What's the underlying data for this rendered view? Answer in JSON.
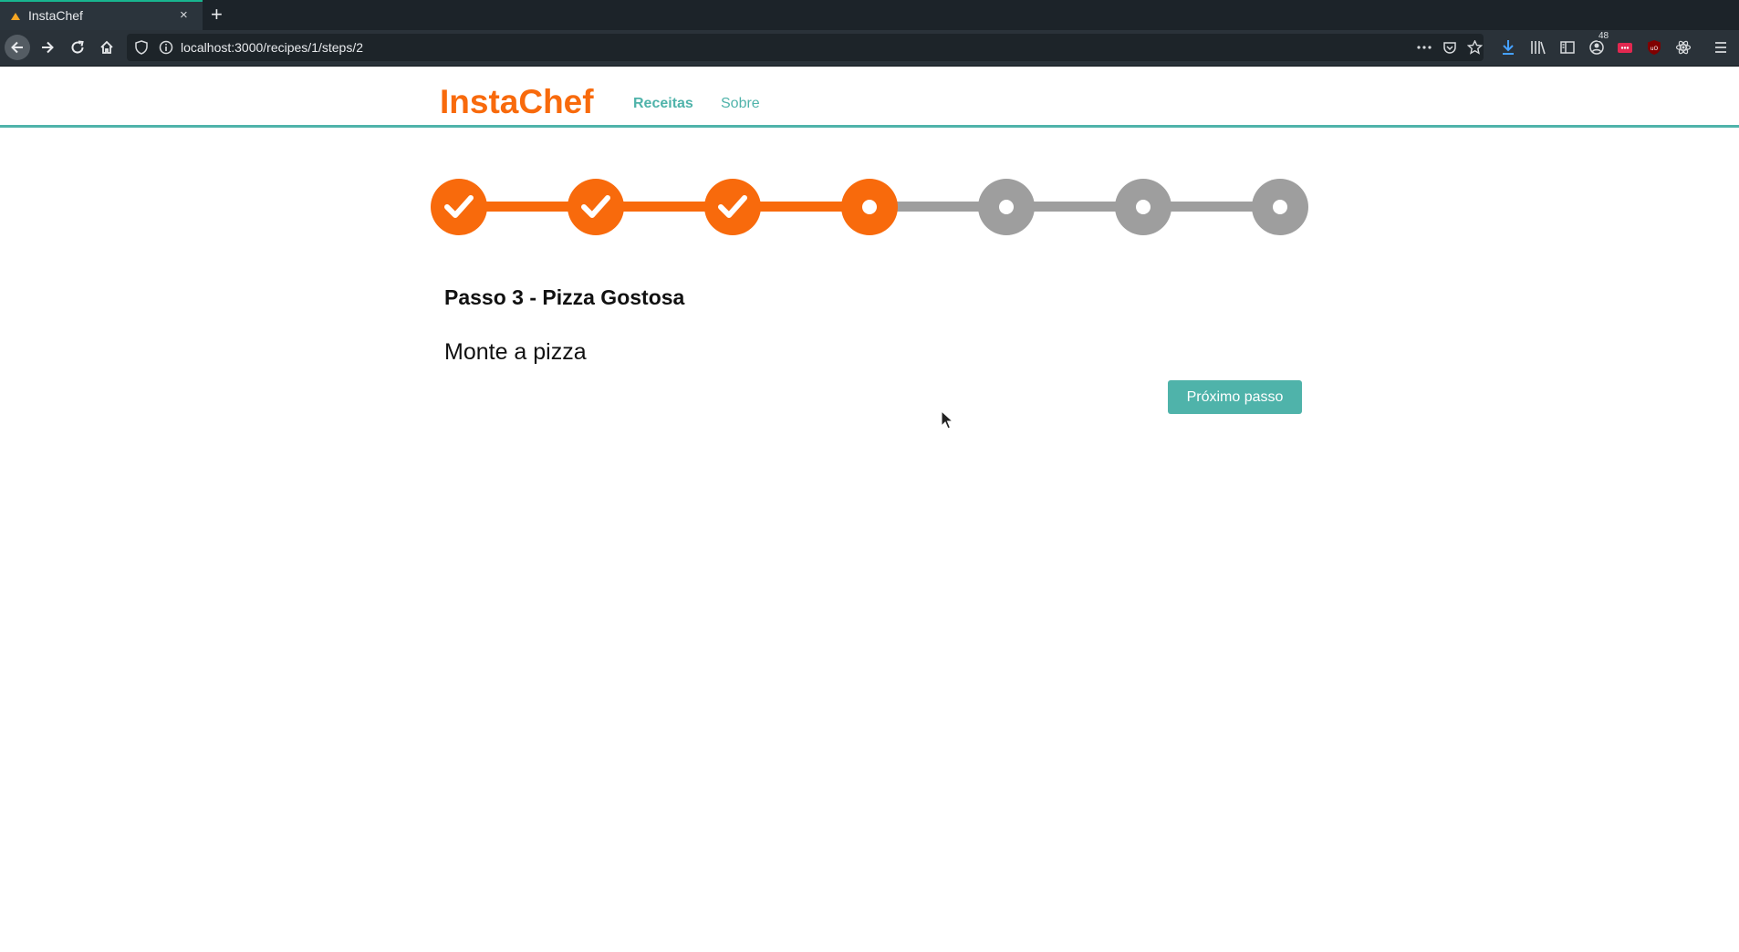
{
  "browser": {
    "tab_title": "InstaChef",
    "new_tab_label": "+",
    "close_label": "×",
    "url": "localhost:3000/recipes/1/steps/2",
    "badge_count": "48"
  },
  "header": {
    "brand": "InstaChef",
    "nav": [
      {
        "label": "Receitas",
        "active": true
      },
      {
        "label": "Sobre",
        "active": false
      }
    ]
  },
  "stepper": {
    "total_steps": 7,
    "completed_steps": 3,
    "current_step": 4,
    "colors": {
      "done": "#f86a0c",
      "todo": "#9e9e9e"
    }
  },
  "step": {
    "title": "Passo 3 - Pizza Gostosa",
    "description": "Monte a pizza",
    "next_button": "Próximo passo"
  },
  "colors": {
    "brand": "#f86a0c",
    "accent": "#4fb3aa"
  }
}
